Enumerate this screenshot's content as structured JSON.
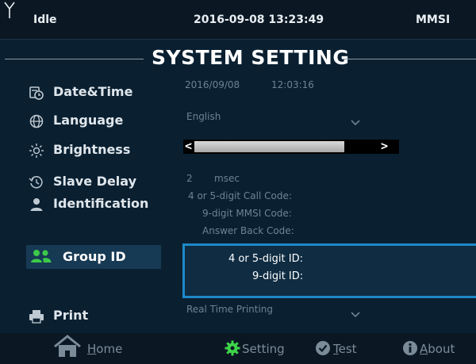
{
  "status_bar": {
    "state": "Idle",
    "datetime": "2016-09-08 13:23:49",
    "mmsi_label": "MMSI"
  },
  "page": {
    "title": "SYSTEM SETTING"
  },
  "menu": {
    "items": [
      {
        "label": "Date&Time",
        "icon": "clock-calendar-icon"
      },
      {
        "label": "Language",
        "icon": "globe-icon"
      },
      {
        "label": "Brightness",
        "icon": "sun-icon"
      },
      {
        "label": "Slave Delay",
        "icon": "history-icon"
      },
      {
        "label": "Identification",
        "icon": "person-icon"
      },
      {
        "label": "Group ID",
        "icon": "group-icon",
        "selected": true
      },
      {
        "label": "Print",
        "icon": "printer-icon"
      }
    ]
  },
  "settings": {
    "date": "2016/09/08",
    "time": "12:03:16",
    "language": "English",
    "brightness_level": 0.8,
    "slave_delay_value": "2",
    "slave_delay_unit": "msec",
    "identification": {
      "call_code_label": "4 or 5-digit Call Code:",
      "mmsi_code_label": "9-digit MMSI Code:",
      "answer_back_label": "Answer Back Code:"
    },
    "group_id": {
      "id_label": "4 or 5-digit ID:",
      "nine_digit_label": "9-digit ID:"
    },
    "print_mode": "Real Time Printing"
  },
  "bottom_nav": {
    "home": {
      "label_first": "H",
      "label_rest": "ome"
    },
    "setting": {
      "label": "Setting"
    },
    "test": {
      "label_first": "T",
      "label_rest": "est"
    },
    "about": {
      "label_first": "A",
      "label_rest": "bout"
    }
  },
  "colors": {
    "background": "#0a2031",
    "accent": "#1e88c8",
    "selected_bg": "#173a54",
    "setting_active": "#3fd44a",
    "group_icon": "#3cc94a"
  }
}
